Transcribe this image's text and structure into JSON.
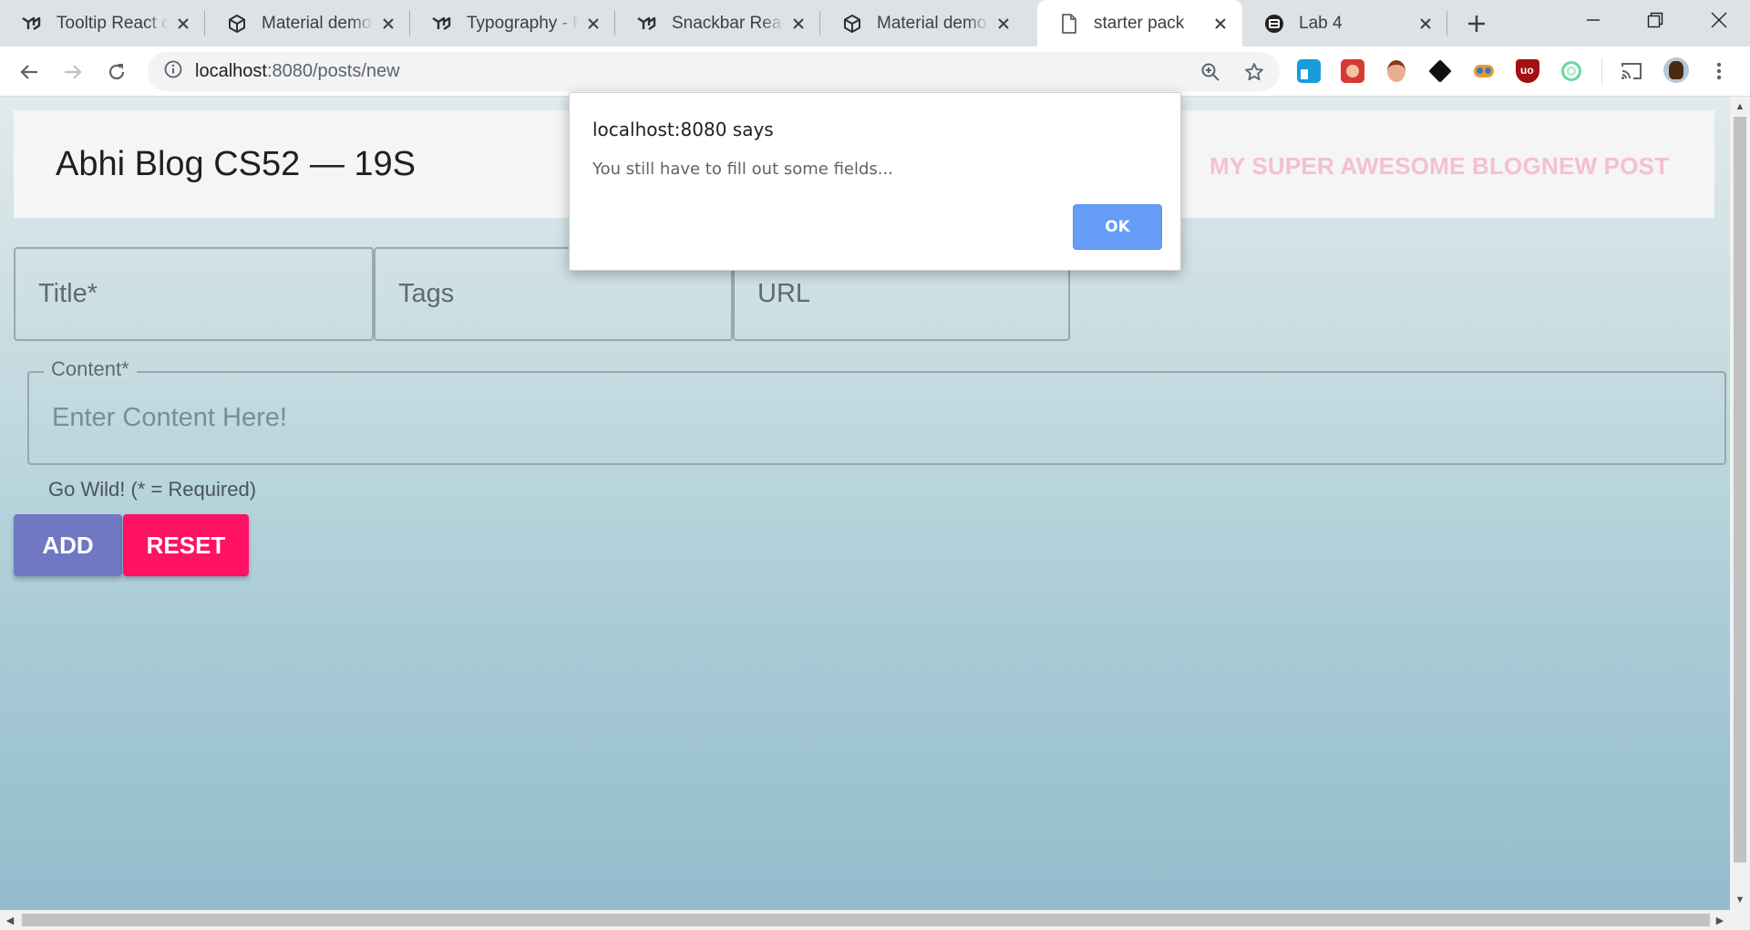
{
  "tabs": [
    {
      "label": "Tooltip React component",
      "icon": "mui-logo-icon"
    },
    {
      "label": "Material demo - CodeSandbox",
      "icon": "cube-icon"
    },
    {
      "label": "Typography - Material-UI",
      "icon": "mui-logo-icon"
    },
    {
      "label": "Snackbar React component",
      "icon": "mui-logo-icon"
    },
    {
      "label": "Material demo - CodeSandbox",
      "icon": "cube-icon"
    },
    {
      "label": "starter pack",
      "icon": "page-icon"
    },
    {
      "label": "Lab 4",
      "icon": "lab-icon"
    }
  ],
  "active_tab_index": 5,
  "address_bar": {
    "host": "localhost",
    "path": ":8080/posts/new"
  },
  "page": {
    "site_title": "Abhi Blog CS52 — 19S",
    "nav_links": [
      "MY SUPER AWESOME BLOG",
      "NEW POST"
    ],
    "fields": {
      "title_placeholder": "Title*",
      "tags_placeholder": "Tags",
      "url_placeholder": "URL",
      "content_label": "Content*",
      "content_placeholder": "Enter Content Here!"
    },
    "helper_text": "Go Wild! (* = Required)",
    "buttons": {
      "add": "ADD",
      "reset": "RESET"
    }
  },
  "alert": {
    "title": "localhost:8080 says",
    "message": "You still have to fill out some fields...",
    "ok_label": "OK"
  },
  "colors": {
    "add_button": "#7078c4",
    "reset_button": "#ff1163",
    "nav_link": "#f4c0d0",
    "alert_ok": "#669df6"
  }
}
